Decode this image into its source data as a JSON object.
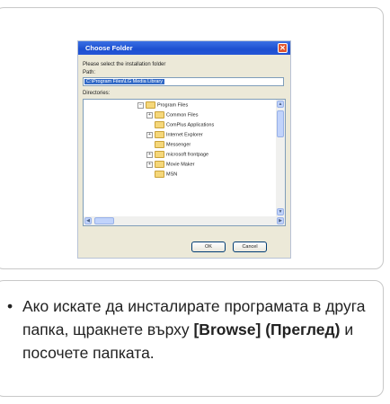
{
  "dialog": {
    "title": "Choose Folder",
    "close_glyph": "✕",
    "instruction": "Please select the installation folder",
    "path_label": "Path:",
    "path_value": "C:\\Program Files\\LG Media Library",
    "directories_label": "Directories:",
    "tree": [
      {
        "label": "Program Files",
        "expander": "−"
      },
      {
        "label": "Common Files",
        "expander": "+"
      },
      {
        "label": "ComPlus Applications",
        "expander": ""
      },
      {
        "label": "Internet Explorer",
        "expander": "+"
      },
      {
        "label": "Messenger",
        "expander": ""
      },
      {
        "label": "microsoft frontpage",
        "expander": "+"
      },
      {
        "label": "Movie Maker",
        "expander": "+"
      },
      {
        "label": "MSN",
        "expander": ""
      }
    ],
    "ok_label": "OK",
    "cancel_label": "Cancel"
  },
  "instruction_text": {
    "bullet": "•",
    "part1": "Ако искате да инсталирате програмата в друга папка, щракнете върху ",
    "bold": "[Browse] (Преглед)",
    "part2": " и посочете папката."
  }
}
